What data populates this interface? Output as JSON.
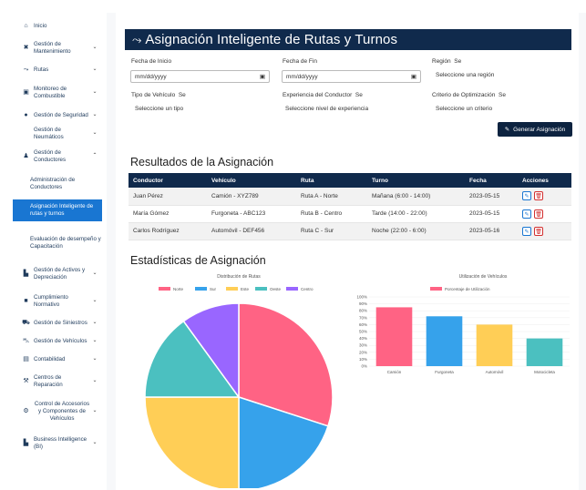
{
  "sidebar": {
    "items": [
      {
        "icon": "home-icon",
        "glyph": "⌂",
        "label": "Inicio",
        "chevron": ""
      },
      {
        "icon": "tools-icon",
        "glyph": "✖",
        "label": "Gestión de Mantenimiento",
        "chevron": "⌄"
      },
      {
        "icon": "route-icon",
        "glyph": "⤳",
        "label": "Rutas",
        "chevron": "⌄"
      },
      {
        "icon": "fuel-icon",
        "glyph": "▣",
        "label": "Monitoreo de Combustible",
        "chevron": "⌄"
      },
      {
        "icon": "shield-icon",
        "glyph": "●",
        "label": "Gestión de Seguridad",
        "chevron": "⌄"
      },
      {
        "icon": "",
        "glyph": "",
        "label": "Gestión de Neumáticos",
        "chevron": "⌄"
      },
      {
        "icon": "user-icon",
        "glyph": "♟",
        "label": "Gestión de Conductores",
        "chevron": "⌃"
      },
      {
        "icon": "",
        "glyph": "",
        "label": "Administración de Conductores",
        "chevron": ""
      },
      {
        "icon": "",
        "glyph": "",
        "label": "Asignación Inteligente de rutas y turnos",
        "chevron": ""
      },
      {
        "icon": "",
        "glyph": "",
        "label": "Evaluación de desempeño y Capacitación",
        "chevron": ""
      },
      {
        "icon": "chart-icon",
        "glyph": "▙",
        "label": "Gestión de Activos y Depreciación",
        "chevron": "⌄"
      },
      {
        "icon": "clipboard-icon",
        "glyph": "■",
        "label": "Cumplimiento Normativo",
        "chevron": "⌄"
      },
      {
        "icon": "car-crash-icon",
        "glyph": "⛟",
        "label": "Gestión de Siniestros",
        "chevron": "⌄"
      },
      {
        "icon": "car-icon",
        "glyph": "⛍",
        "label": "Gestión de Vehículos",
        "chevron": "⌄"
      },
      {
        "icon": "calculator-icon",
        "glyph": "▤",
        "label": "Contabilidad",
        "chevron": "⌄"
      },
      {
        "icon": "wrench-icon",
        "glyph": "⚒",
        "label": "Centros de Reparación",
        "chevron": "⌄"
      },
      {
        "icon": "parts-icon",
        "glyph": "⚙",
        "label": "Control de Accesorios y Componentes de Vehículos",
        "chevron": "⌄"
      },
      {
        "icon": "bi-icon",
        "glyph": "▙",
        "label": "Business Intelligence (BI)",
        "chevron": "⌄"
      }
    ]
  },
  "page": {
    "title": "Asignación Inteligente de Rutas y Turnos"
  },
  "form": {
    "start_label": "Fecha de Inicio",
    "start_value": "mm/dd/yyyy",
    "end_label": "Fecha de Fin",
    "end_value": "mm/dd/yyyy",
    "region_label": "Región",
    "region_trunc": "Se",
    "region_value": "Seleccione una región",
    "vehicle_label": "Tipo de Vehículo",
    "vehicle_trunc": "Se",
    "vehicle_value": "Seleccione un tipo",
    "exp_label": "Experiencia del Conductor",
    "exp_trunc": "Se",
    "exp_value": "Seleccione nivel de experiencia",
    "crit_label": "Criterio de Optimización",
    "crit_trunc": "Se",
    "crit_value": "Seleccione un criterio",
    "generate_label": "Generar Asignación"
  },
  "results": {
    "heading": "Resultados de la Asignación",
    "columns": [
      "Conductor",
      "Vehículo",
      "Ruta",
      "Turno",
      "Fecha",
      "Acciones"
    ],
    "rows": [
      [
        "Juan Pérez",
        "Camión - XYZ789",
        "Ruta A - Norte",
        "Mañana (6:00 - 14:00)",
        "2023-05-15"
      ],
      [
        "María Gómez",
        "Furgoneta - ABC123",
        "Ruta B - Centro",
        "Tarde (14:00 - 22:00)",
        "2023-05-15"
      ],
      [
        "Carlos Rodríguez",
        "Automóvil - DEF456",
        "Ruta C - Sur",
        "Noche (22:00 - 6:00)",
        "2023-05-16"
      ]
    ]
  },
  "stats": {
    "heading": "Estadísticas de Asignación"
  },
  "chart_data": [
    {
      "type": "pie",
      "title": "Distribución de Rutas",
      "categories": [
        "Norte",
        "Sur",
        "Este",
        "Oeste",
        "Centro"
      ],
      "values": [
        30,
        20,
        25,
        15,
        10
      ],
      "colors": [
        "#ff6384",
        "#36a2eb",
        "#ffce56",
        "#4bc0c0",
        "#9966ff"
      ],
      "legend": "top"
    },
    {
      "type": "bar",
      "title": "Utilización de Vehículos",
      "categories": [
        "Camión",
        "Furgoneta",
        "Automóvil",
        "Motocicleta"
      ],
      "series": [
        {
          "name": "Porcentaje de Utilización",
          "values": [
            85,
            72,
            60,
            40
          ]
        }
      ],
      "colors": [
        "#ff6384",
        "#36a2eb",
        "#ffce56",
        "#4bc0c0"
      ],
      "ylim": [
        0,
        100
      ],
      "yticks": [
        "100%",
        "90%",
        "80%",
        "70%",
        "60%",
        "50%",
        "40%",
        "30%",
        "20%",
        "10%",
        "0%"
      ],
      "legend": "top"
    }
  ]
}
